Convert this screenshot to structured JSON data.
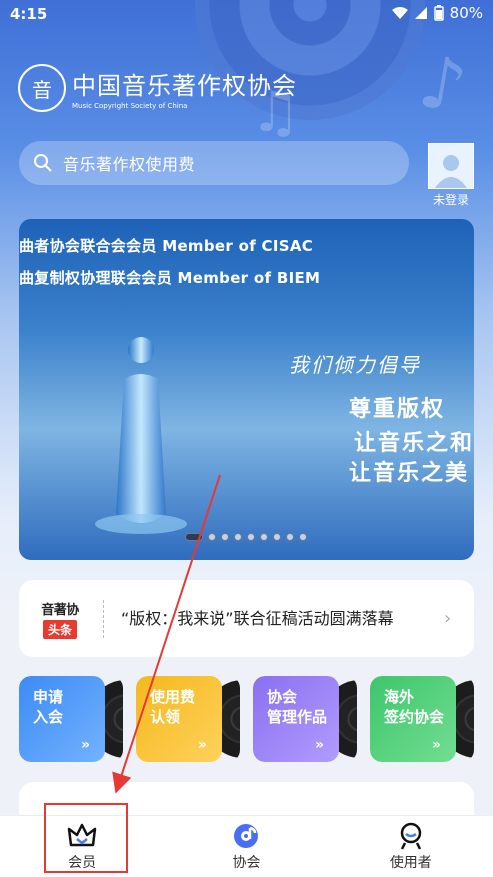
{
  "status_bar": {
    "time": "4:15",
    "battery": "80%"
  },
  "logo": {
    "cn": "中国音乐著作权协会",
    "en": "Music Copyright Society of China",
    "mark": "音"
  },
  "search": {
    "placeholder": "音乐著作权使用费"
  },
  "user": {
    "login_label": "未登录"
  },
  "banner": {
    "line1": "曲者协会联合会会员 Member of CISAC",
    "line2": "曲复制权协理联会会员 Member of BIEM",
    "headline": "我们倾力倡导",
    "slogan1": "尊重版权",
    "slogan2": "让音乐之和",
    "slogan3": "让音乐之美",
    "dot_count": 9,
    "active_dot": 0
  },
  "news": {
    "logo_top": "音著协",
    "logo_bottom": "头条",
    "headline": "“版权：我来说”联合征稿活动圆满落幕",
    "chevron": "›"
  },
  "cards": [
    {
      "line1": "申请",
      "line2": "入会",
      "color": "#3c8bf5"
    },
    {
      "line1": "使用费",
      "line2": "认领",
      "color": "#f5b81d"
    },
    {
      "line1": "协会",
      "line2": "管理作品",
      "color": "#8b6ff0"
    },
    {
      "line1": "海外",
      "line2": "签约协会",
      "color": "#3ec56b"
    }
  ],
  "card_arrow": "»",
  "bottom_nav": [
    {
      "label": "会员",
      "icon": "crown-icon"
    },
    {
      "label": "协会",
      "icon": "music-disc-icon"
    },
    {
      "label": "使用者",
      "icon": "user-badge-icon"
    }
  ],
  "annotation": {
    "highlight_color": "#e53935"
  }
}
